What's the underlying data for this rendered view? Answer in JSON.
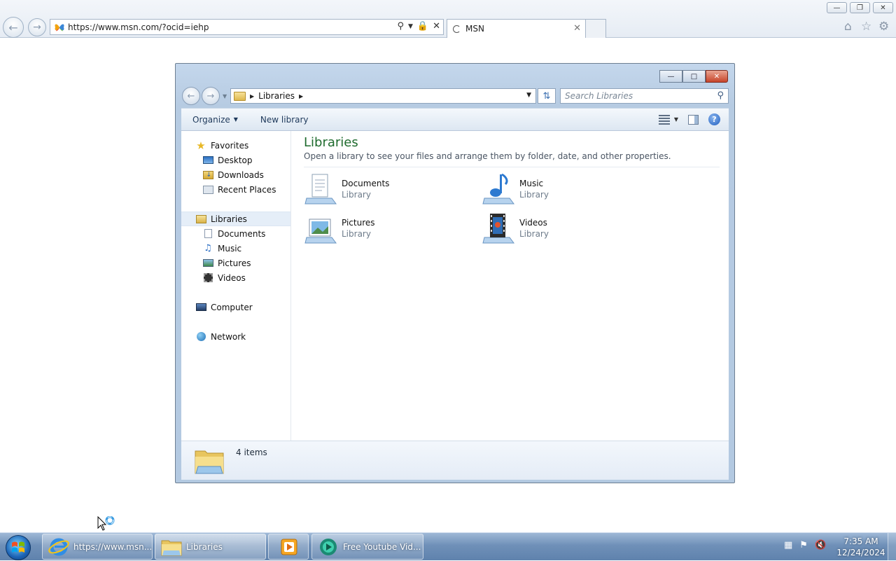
{
  "browser": {
    "url": "https://www.msn.com/?ocid=iehp",
    "tab_title": "MSN",
    "tab_close": "✕",
    "buttons": {
      "minimize": "—",
      "maximize": "❐",
      "close": "✕"
    }
  },
  "explorer": {
    "window_buttons": {
      "minimize": "—",
      "maximize": "□",
      "close": "✕"
    },
    "breadcrumb": "Libraries",
    "search_placeholder": "Search Libraries",
    "toolbar": {
      "organize": "Organize",
      "new_library": "New library"
    },
    "nav": {
      "favorites": "Favorites",
      "favorites_items": [
        "Desktop",
        "Downloads",
        "Recent Places"
      ],
      "libraries": "Libraries",
      "libraries_items": [
        "Documents",
        "Music",
        "Pictures",
        "Videos"
      ],
      "computer": "Computer",
      "network": "Network"
    },
    "content": {
      "title": "Libraries",
      "subtitle": "Open a library to see your files and arrange them by folder, date, and other properties.",
      "libraries": [
        {
          "name": "Documents",
          "type": "Library",
          "icon": "documents-library-icon"
        },
        {
          "name": "Music",
          "type": "Library",
          "icon": "music-library-icon"
        },
        {
          "name": "Pictures",
          "type": "Library",
          "icon": "pictures-library-icon"
        },
        {
          "name": "Videos",
          "type": "Library",
          "icon": "videos-library-icon"
        }
      ]
    },
    "status": "4 items"
  },
  "taskbar": {
    "buttons": [
      {
        "label": "https://www.msn...",
        "icon": "internet-explorer-icon"
      },
      {
        "label": "Libraries",
        "icon": "libraries-folder-icon"
      },
      {
        "label": "",
        "icon": "media-player-icon"
      },
      {
        "label": "Free Youtube Vid...",
        "icon": "youtube-downloader-icon"
      }
    ],
    "clock": {
      "time": "7:35 AM",
      "date": "12/24/2024"
    }
  }
}
